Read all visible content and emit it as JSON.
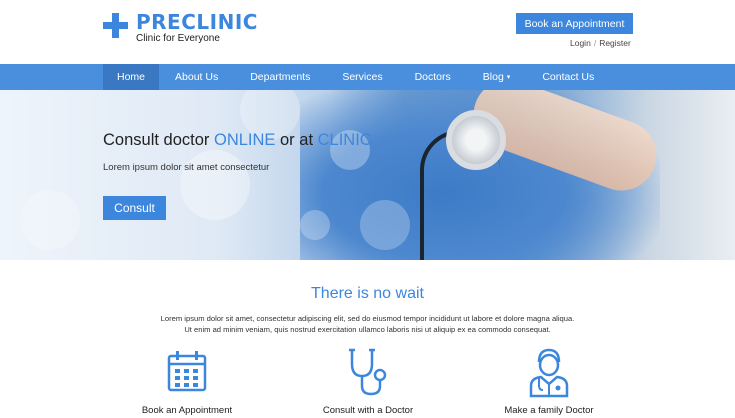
{
  "header": {
    "brand": "PRECLINIC",
    "tagline": "Clinic for Everyone",
    "appointment_button": "Book an Appointment",
    "login": "Login",
    "separator": "/",
    "register": "Register"
  },
  "nav": {
    "items": [
      {
        "label": "Home",
        "active": true
      },
      {
        "label": "About Us"
      },
      {
        "label": "Departments"
      },
      {
        "label": "Services"
      },
      {
        "label": "Doctors"
      },
      {
        "label": "Blog",
        "dropdown": true
      },
      {
        "label": "Contact Us"
      }
    ],
    "dropdown_caret": "▾"
  },
  "hero": {
    "title_part1": "Consult doctor ",
    "title_highlight1": "ONLINE",
    "title_part2": " or at ",
    "title_highlight2": "CLINIC",
    "subtitle": "Lorem ipsum dolor sit amet consectetur",
    "cta": "Consult"
  },
  "section": {
    "title": "There is no wait",
    "text_line1": "Lorem ipsum dolor sit amet, consectetur adipiscing elit, sed do eiusmod tempor incididunt ut labore et dolore magna aliqua.",
    "text_line2": "Ut enim ad minim veniam, quis nostrud exercitation ullamco laboris nisi ut aliquip ex ea commodo consequat."
  },
  "features": [
    {
      "label": "Book an Appointment",
      "icon": "calendar-icon"
    },
    {
      "label": "Consult with a Doctor",
      "icon": "stethoscope-icon"
    },
    {
      "label": "Make a family Doctor",
      "icon": "doctor-icon"
    }
  ],
  "colors": {
    "accent": "#3c87dd",
    "nav_bg": "#4a8fde",
    "nav_active": "#3a78c4"
  }
}
